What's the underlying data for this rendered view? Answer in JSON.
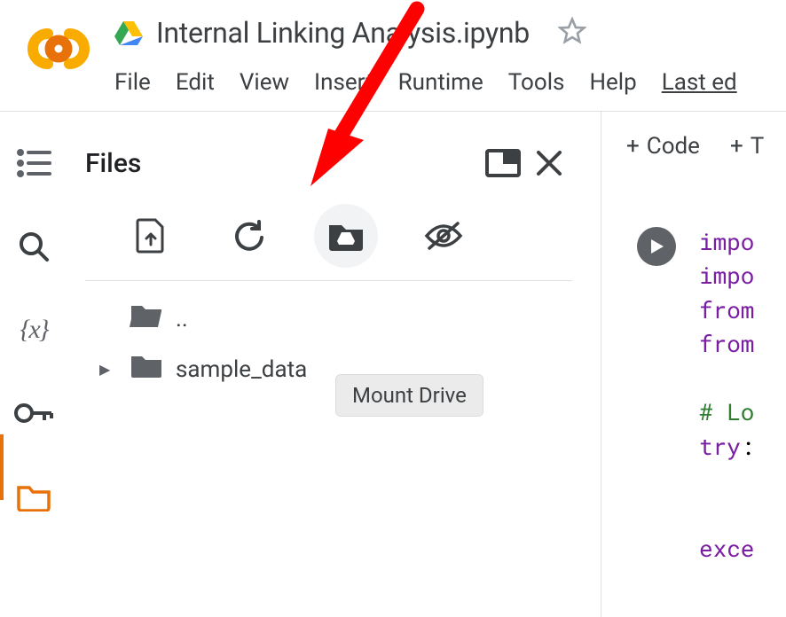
{
  "title": "Internal Linking Analysis.ipynb",
  "menu": [
    "File",
    "Edit",
    "View",
    "Insert",
    "Runtime",
    "Tools",
    "Help",
    "Last ed"
  ],
  "panel": {
    "title": "Files",
    "tooltip": "Mount Drive",
    "items": [
      {
        "label": "..",
        "kind": "up"
      },
      {
        "label": "sample_data",
        "kind": "folder"
      }
    ]
  },
  "notebook": {
    "insert_buttons": {
      "code": "Code",
      "text": "T"
    },
    "code_lines": [
      {
        "t": "kw",
        "v": "impo"
      },
      {
        "t": "kw",
        "v": "impo"
      },
      {
        "t": "kw",
        "v": "from"
      },
      {
        "t": "kw",
        "v": "from"
      },
      {
        "t": "",
        "v": ""
      },
      {
        "t": "cm",
        "v": "# Lo"
      },
      {
        "t": "kw",
        "v": "try"
      },
      {
        "t": "pn",
        "v": ":"
      },
      {
        "t": "",
        "v": ""
      },
      {
        "t": "",
        "v": ""
      },
      {
        "t": "kw",
        "v": "exce"
      }
    ]
  }
}
